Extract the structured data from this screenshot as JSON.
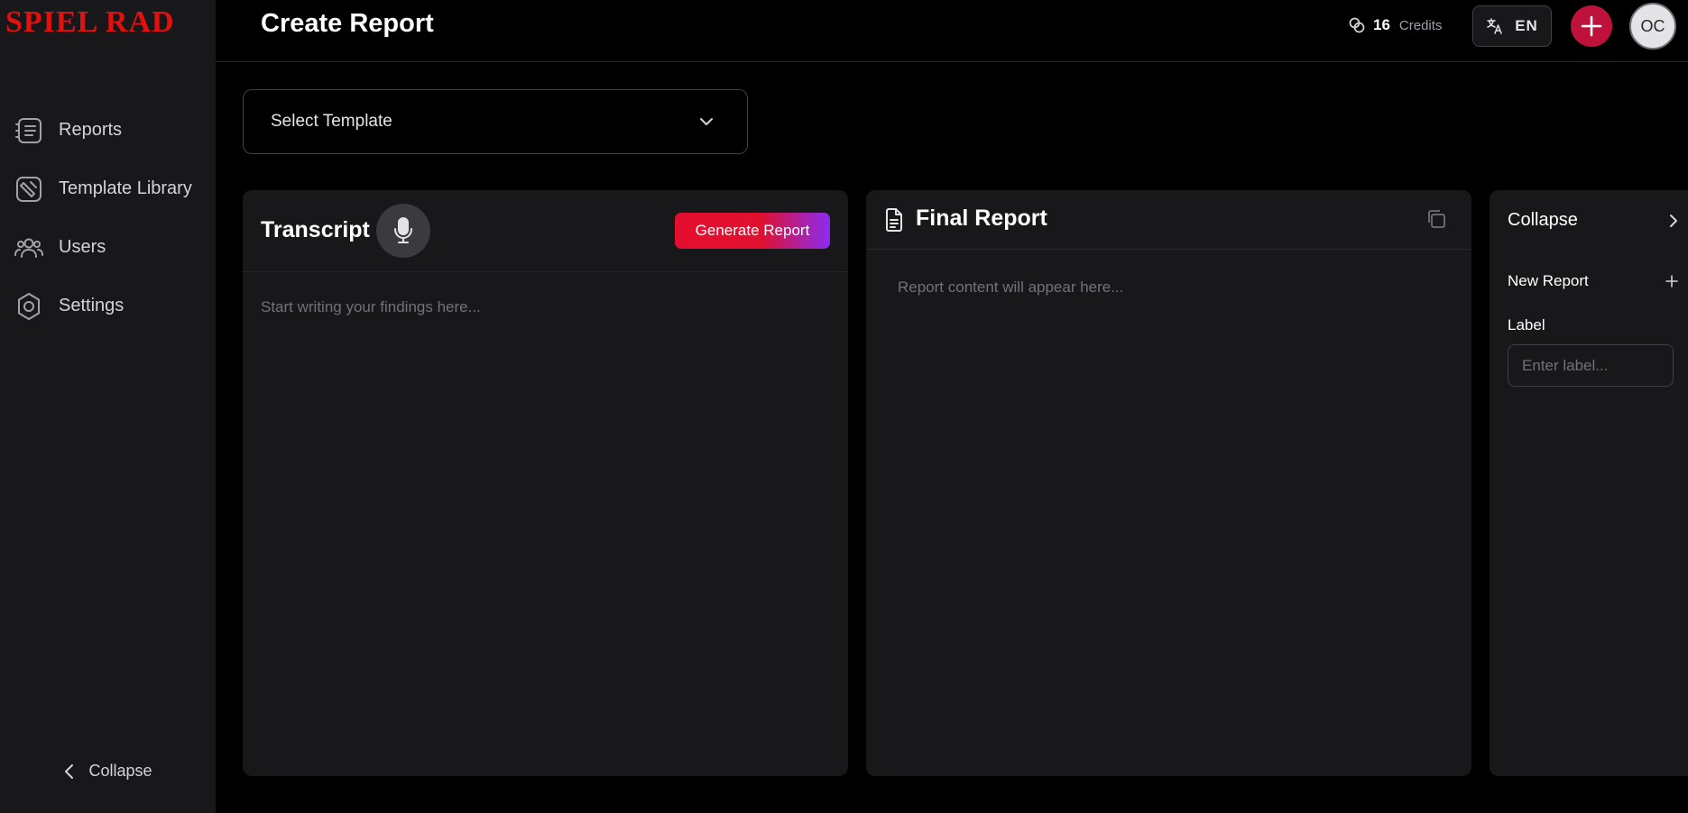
{
  "brand": {
    "logo_text": "SPIEL RAD",
    "logo_color": "#e3100e"
  },
  "header": {
    "title": "Create Report",
    "credits_count": "16",
    "credits_label": "Credits",
    "language_code": "EN",
    "avatar_initials": "OC"
  },
  "sidebar": {
    "items": [
      {
        "label": "Reports",
        "icon": "reports-list-icon"
      },
      {
        "label": "Template Library",
        "icon": "template-library-icon"
      },
      {
        "label": "Users",
        "icon": "users-icon"
      },
      {
        "label": "Settings",
        "icon": "gear-icon"
      }
    ],
    "collapse_label": "Collapse"
  },
  "template_select": {
    "value": "Select Template"
  },
  "transcript": {
    "title": "Transcript",
    "generate_label": "Generate Report",
    "placeholder": "Start writing your findings here..."
  },
  "final_report": {
    "title": "Final Report",
    "placeholder": "Report content will appear here..."
  },
  "side_panel": {
    "collapse_label": "Collapse",
    "new_report_label": "New Report",
    "label_title": "Label",
    "label_placeholder": "Enter label..."
  },
  "colors": {
    "accent_red": "#be123c",
    "generate_gradient_start": "#e60e2e",
    "generate_gradient_end": "#8b2cf0",
    "panel_bg": "#18181b"
  }
}
